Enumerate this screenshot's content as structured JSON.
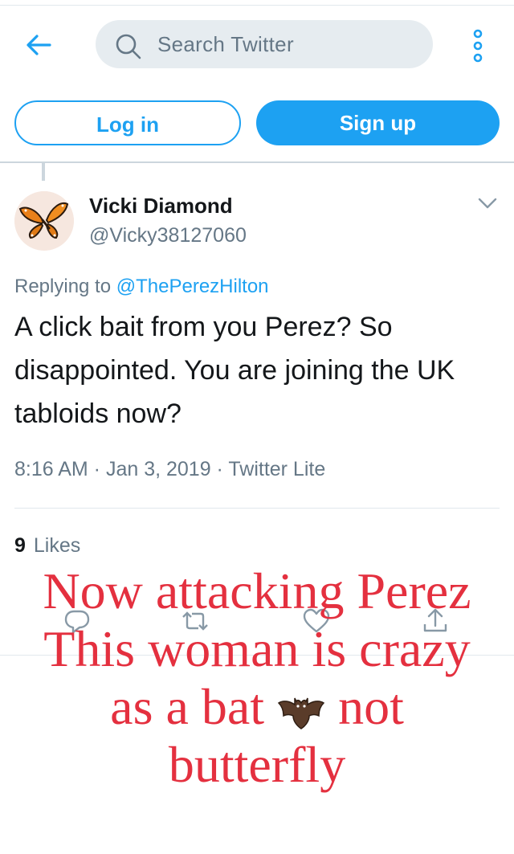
{
  "header": {
    "search_placeholder": "Search Twitter",
    "login_label": "Log in",
    "signup_label": "Sign up",
    "accent": "#1da1f2"
  },
  "tweet": {
    "author_name": "Vicki Diamond",
    "author_handle": "@Vicky38127060",
    "replying_prefix": "Replying to ",
    "replying_to": "@ThePerezHilton",
    "text": "A click bait from you Perez? So disappointed. You are joining the UK tabloids now?",
    "meta": "8:16 AM · Jan 3, 2019 · Twitter Lite",
    "likes_count": "9",
    "likes_label": "Likes"
  },
  "overlay": {
    "line1": "Now attacking Perez",
    "line2": "This woman is crazy",
    "line3_a": "as a bat",
    "line3_b": "not",
    "line4": "butterfly",
    "color": "#e4303f"
  },
  "icons": [
    "back-arrow-icon",
    "search-icon",
    "more-options-icon",
    "butterfly-avatar",
    "chevron-down-icon",
    "reply-icon",
    "retweet-icon",
    "like-icon",
    "share-icon",
    "bat-emoji"
  ]
}
